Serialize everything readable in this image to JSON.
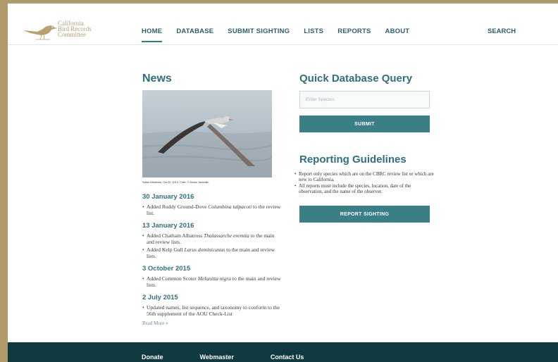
{
  "logo": {
    "line1": "California",
    "line2": "Bird Records",
    "line3": "Committee"
  },
  "nav": {
    "items": [
      {
        "label": "HOME",
        "active": true
      },
      {
        "label": "DATABASE"
      },
      {
        "label": "SUBMIT SIGHTING"
      },
      {
        "label": "LISTS"
      },
      {
        "label": "REPORTS"
      },
      {
        "label": "ABOUT"
      }
    ],
    "search": "SEARCH"
  },
  "news": {
    "title": "News",
    "caption": "Salvin Albatross, Oct 20, 2013, Chile, © Alvaro Jaramillo",
    "read_more": "Read More »",
    "entries": [
      {
        "date": "30 January 2016"
      },
      {
        "date": "13 January 2016"
      },
      {
        "date": "3 October 2015"
      },
      {
        "date": "2 July 2015"
      }
    ],
    "items": {
      "a1_pre": "Added Ruddy Ground-Dove ",
      "a1_sci": "Columbina talpacoti",
      "a1_post": " to the review list.",
      "b1_pre": "Added Chatham Albatross ",
      "b1_sci": "Thalassarche eremita",
      "b1_post": " to the main and review lists.",
      "b2_pre": "Added Kelp Gull ",
      "b2_sci": "Larus dominicanus",
      "b2_post": " to the main and review lists.",
      "c1_pre": "Added Common Scoter ",
      "c1_sci": "Melanitta nigra",
      "c1_post": " to the main and review lists.",
      "d1": "Updated names, list sequence, and taxonomy to conform to the 56th supplement of the AOU Check-List"
    }
  },
  "query": {
    "title": "Quick Database Query",
    "placeholder": "Enter Species",
    "submit": "SUBMIT"
  },
  "guidelines": {
    "title": "Reporting Guidelines",
    "items": [
      "Report only species which are on the CBRC review list or which are new to California.",
      "All reports must include the species, location, date of the observation, and the name of the observer."
    ],
    "button": "REPORT SIGHTING"
  },
  "footer": {
    "links": [
      "Donate",
      "Webmaster",
      "Contact Us"
    ]
  },
  "colors": {
    "accent": "#3b7f86",
    "heading": "#2f6f7e",
    "footer": "#0f3b40",
    "frame": "#b09a6a"
  }
}
